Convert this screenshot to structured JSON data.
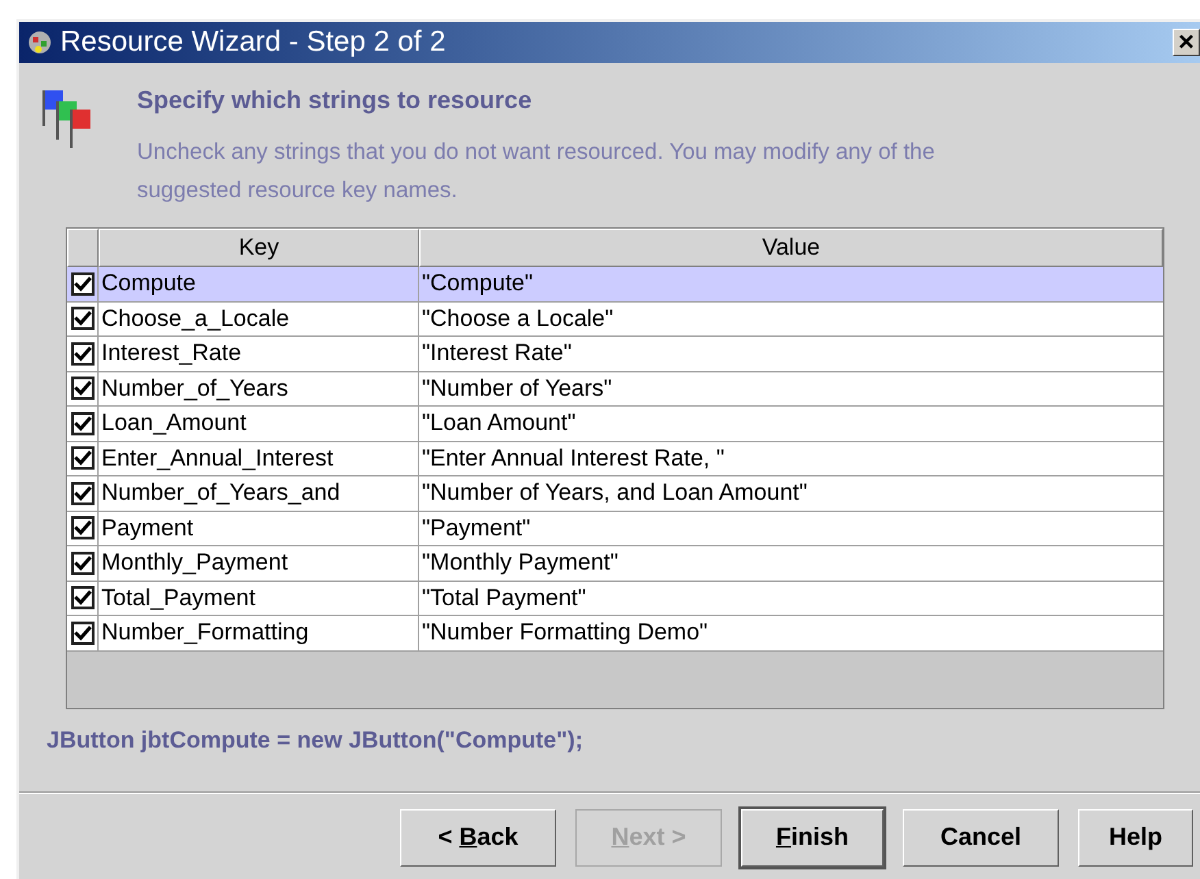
{
  "window": {
    "title": "Resource Wizard - Step 2 of 2",
    "close": "×"
  },
  "header": {
    "title": "Specify which strings to resource",
    "description": "Uncheck any strings that you do not want resourced. You may modify any of the suggested resource key names."
  },
  "table": {
    "columns": [
      "Key",
      "Value"
    ],
    "rows": [
      {
        "checked": true,
        "selected": true,
        "key": "Compute",
        "value": "\"Compute\""
      },
      {
        "checked": true,
        "selected": false,
        "key": "Choose_a_Locale",
        "value": "\"Choose a Locale\""
      },
      {
        "checked": true,
        "selected": false,
        "key": "Interest_Rate",
        "value": "\"Interest Rate\""
      },
      {
        "checked": true,
        "selected": false,
        "key": "Number_of_Years",
        "value": "\"Number of Years\""
      },
      {
        "checked": true,
        "selected": false,
        "key": "Loan_Amount",
        "value": "\"Loan Amount\""
      },
      {
        "checked": true,
        "selected": false,
        "key": "Enter_Annual_Interest",
        "value": "\"Enter Annual Interest Rate, \""
      },
      {
        "checked": true,
        "selected": false,
        "key": "Number_of_Years_and",
        "value": "\"Number of Years, and Loan Amount\""
      },
      {
        "checked": true,
        "selected": false,
        "key": "Payment",
        "value": "\"Payment\""
      },
      {
        "checked": true,
        "selected": false,
        "key": "Monthly_Payment",
        "value": "\"Monthly Payment\""
      },
      {
        "checked": true,
        "selected": false,
        "key": "Total_Payment",
        "value": "\"Total Payment\""
      },
      {
        "checked": true,
        "selected": false,
        "key": "Number_Formatting",
        "value": "\"Number Formatting Demo\""
      }
    ]
  },
  "code_preview": "JButton jbtCompute = new JButton(\"Compute\");",
  "buttons": [
    {
      "label_parts": [
        {
          "text": "< ",
          "underlined": false
        },
        {
          "text": "B",
          "underlined": true
        },
        {
          "text": "ack",
          "underlined": false
        }
      ],
      "disabled": false,
      "default": false
    },
    {
      "label_parts": [
        {
          "text": "N",
          "underlined": true
        },
        {
          "text": "ext >",
          "underlined": false
        }
      ],
      "disabled": true,
      "default": false
    },
    {
      "label_parts": [
        {
          "text": "F",
          "underlined": true
        },
        {
          "text": "inish",
          "underlined": false
        }
      ],
      "disabled": false,
      "default": true
    },
    {
      "label_parts": [
        {
          "text": "Cancel",
          "underlined": false
        }
      ],
      "disabled": false,
      "default": false
    },
    {
      "label_parts": [
        {
          "text": "Help",
          "underlined": false
        }
      ],
      "disabled": false,
      "default": false
    }
  ]
}
